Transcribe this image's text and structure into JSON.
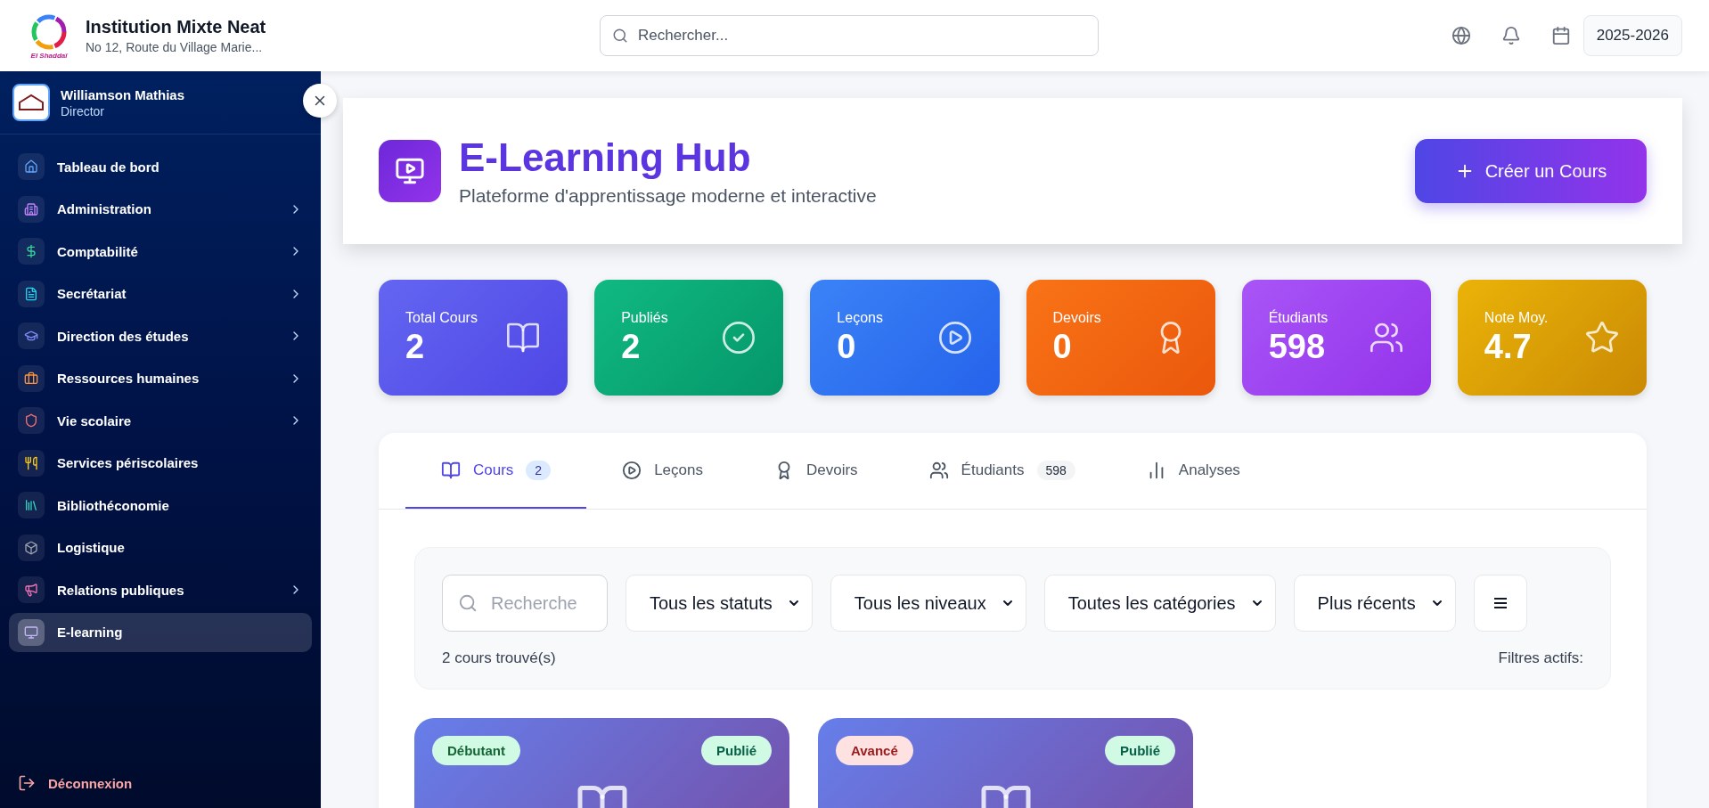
{
  "header": {
    "logo_text": "El Shaddaï",
    "school_name": "Institution Mixte Neat",
    "address": "No 12, Route du Village Marie...",
    "search": {
      "placeholder": "Rechercher..."
    },
    "year": "2025-2026"
  },
  "user": {
    "name": "Williamson Mathias",
    "role": "Director"
  },
  "sidebar": {
    "items": [
      {
        "label": "Tableau de bord",
        "submenu": false,
        "selected": false
      },
      {
        "label": "Administration",
        "submenu": true,
        "selected": false
      },
      {
        "label": "Comptabilité",
        "submenu": true,
        "selected": false
      },
      {
        "label": "Secrétariat",
        "submenu": true,
        "selected": false
      },
      {
        "label": "Direction des études",
        "submenu": true,
        "selected": false
      },
      {
        "label": "Ressources humaines",
        "submenu": true,
        "selected": false
      },
      {
        "label": "Vie scolaire",
        "submenu": true,
        "selected": false
      },
      {
        "label": "Services périscolaires",
        "submenu": false,
        "selected": false
      },
      {
        "label": "Bibliothéconomie",
        "submenu": false,
        "selected": false
      },
      {
        "label": "Logistique",
        "submenu": false,
        "selected": false
      },
      {
        "label": "Relations publiques",
        "submenu": true,
        "selected": false
      },
      {
        "label": "E-learning",
        "submenu": false,
        "selected": true
      }
    ],
    "logout": "Déconnexion"
  },
  "hero": {
    "title": "E-Learning Hub",
    "subtitle": "Plateforme d'apprentissage moderne et interactive",
    "button": "Créer un Cours"
  },
  "stats": [
    {
      "label": "Total Cours",
      "value": "2"
    },
    {
      "label": "Publiés",
      "value": "2"
    },
    {
      "label": "Leçons",
      "value": "0"
    },
    {
      "label": "Devoirs",
      "value": "0"
    },
    {
      "label": "Étudiants",
      "value": "598"
    },
    {
      "label": "Note Moy.",
      "value": "4.7"
    }
  ],
  "tabs": [
    {
      "label": "Cours",
      "count": "2",
      "selected": true
    },
    {
      "label": "Leçons",
      "selected": false
    },
    {
      "label": "Devoirs",
      "selected": false
    },
    {
      "label": "Étudiants",
      "count": "598",
      "selected": false
    },
    {
      "label": "Analyses",
      "selected": false
    }
  ],
  "filters": {
    "search": {
      "placeholder": "Recherche"
    },
    "selects": [
      "Tous les statuts",
      "Tous les niveaux",
      "Toutes les catégories",
      "Plus récents"
    ],
    "result_count": "2 cours trouvé(s)",
    "active_filters": "Filtres actifs:"
  },
  "courses": [
    {
      "level": {
        "label": "Débutant",
        "kind": "beginner"
      },
      "status": "Publié"
    },
    {
      "level": {
        "label": "Avancé",
        "kind": "advanced"
      },
      "status": "Publié"
    }
  ]
}
